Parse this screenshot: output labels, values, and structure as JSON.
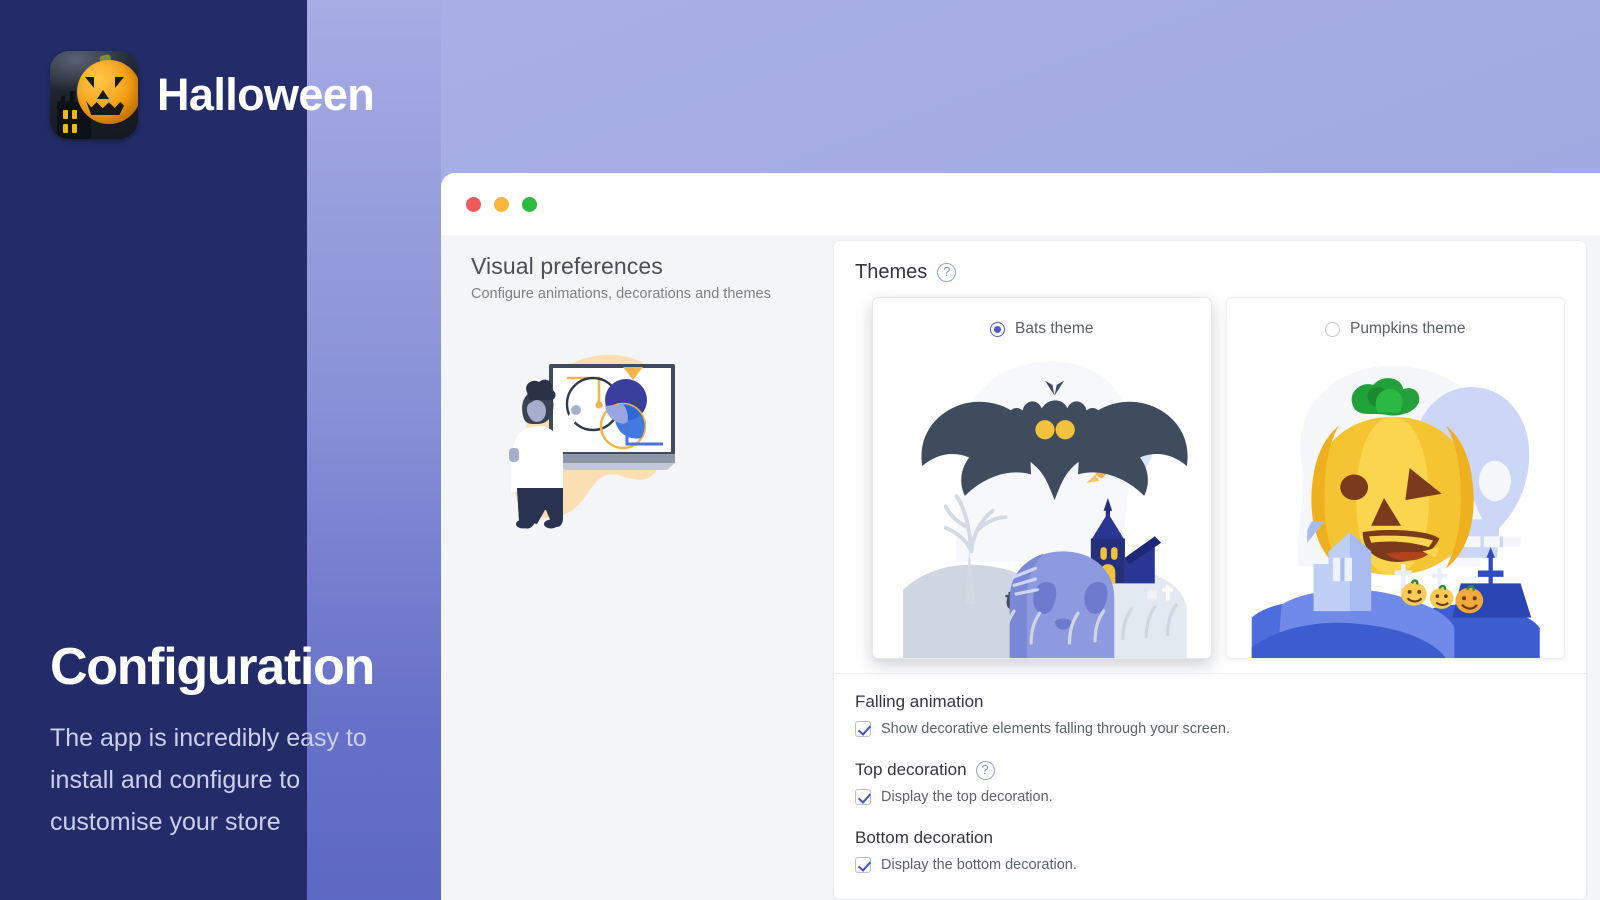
{
  "promo": {
    "app_name": "Halloween",
    "app_icon": "jack-o-lantern-icon",
    "heading": "Configuration",
    "description": "The app is incredibly easy to install and configure to customise your store"
  },
  "window": {
    "traffic_lights": [
      {
        "name": "close",
        "color": "#f0595b"
      },
      {
        "name": "minimise",
        "color": "#f7b73e"
      },
      {
        "name": "maximise",
        "color": "#2cbb3f"
      }
    ]
  },
  "left": {
    "title": "Visual preferences",
    "subtitle": "Configure animations, decorations and themes",
    "illustration": "person-presenting-chart-illustration"
  },
  "themes_panel": {
    "title": "Themes",
    "help_icon": "help-circle-icon",
    "help_glyph": "?",
    "cards": [
      {
        "label": "Bats theme",
        "selected": true,
        "illustration": "bat-graveyard-illustration"
      },
      {
        "label": "Pumpkins theme",
        "selected": false,
        "illustration": "pumpkin-skull-illustration"
      }
    ]
  },
  "options": [
    {
      "title": "Falling animation",
      "has_help": false,
      "checked": true,
      "description": "Show decorative elements falling through your screen."
    },
    {
      "title": "Top decoration",
      "has_help": true,
      "help_glyph": "?",
      "checked": true,
      "description": "Display the top decoration."
    },
    {
      "title": "Bottom decoration",
      "has_help": false,
      "checked": true,
      "description": "Display the bottom decoration."
    }
  ],
  "colors": {
    "sidebar_dark": "#232c68",
    "sidebar_mid": "#5d68c4",
    "backdrop": "#a3abe3",
    "accent_radio": "#4f57c8",
    "accent_check": "#3b53d0",
    "help_icon": "#7e97b4"
  }
}
